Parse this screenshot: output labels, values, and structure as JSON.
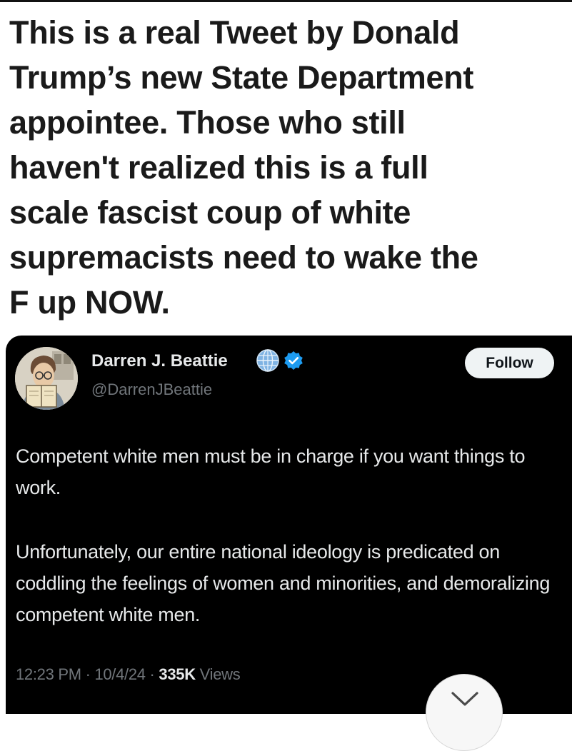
{
  "caption": {
    "lines": [
      "This is a real Tweet by Donald",
      "Trump’s new State Department",
      "appointee. Those who still",
      "haven't realized this is a full",
      "scale fascist coup of white",
      "supremacists need to wake the",
      "F up NOW."
    ]
  },
  "tweet": {
    "author_name": "Darren J. Beattie",
    "handle": "@DarrenJBeattie",
    "follow_label": "Follow",
    "avatar_icon": "cartoon-man-reading-book-avatar",
    "badges": [
      "globe-icon",
      "verified-badge-icon"
    ],
    "paragraphs": [
      "Competent white men must be in charge if you want things to work.",
      "Unfortunately, our entire national ideology is predicated on coddling the feelings of women and minorities, and demoralizing competent white men."
    ],
    "time": "12:23 PM",
    "date": "10/4/24",
    "separator": " · ",
    "views_count": "335K",
    "views_label": "Views"
  },
  "overlay": {
    "scroll_icon": "chevron-down-icon"
  },
  "colors": {
    "caption_text": "#1a1a1a",
    "card_bg": "#000000",
    "primary_text": "#e7e9ea",
    "secondary_text": "#71767b",
    "verified_blue": "#1d9bf0",
    "follow_bg": "#eff3f4"
  }
}
